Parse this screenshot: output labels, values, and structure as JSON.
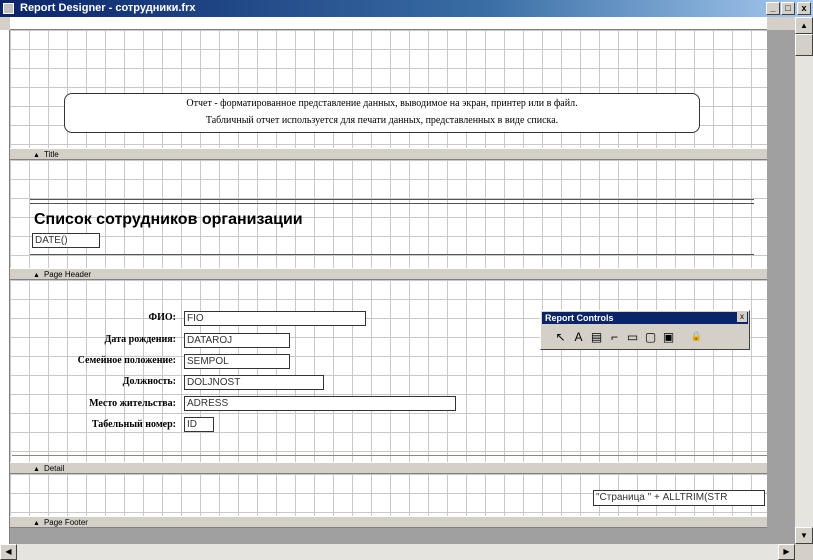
{
  "window": {
    "title": "Report Designer - сотрудники.frx",
    "minimize_glyph": "_",
    "restore_glyph": "□",
    "close_glyph": "x"
  },
  "bands": {
    "title": "Title",
    "page_header": "Page Header",
    "detail": "Detail",
    "page_footer": "Page Footer"
  },
  "description": {
    "line1": "Отчет - форматированное представление данных, выводимое на экран, принтер или в файл.",
    "line2": "Табличный отчет используется для печати данных, представленных в виде списка."
  },
  "report": {
    "heading": "Список сотрудников организации",
    "date_field": "DATE()"
  },
  "detail_fields": [
    {
      "label": "ФИО:",
      "expr": "FIO"
    },
    {
      "label": "Дата рождения:",
      "expr": "DATAROJ"
    },
    {
      "label": "Семейное положение:",
      "expr": "SEMPOL"
    },
    {
      "label": "Должность:",
      "expr": "DOLJNOST"
    },
    {
      "label": "Место жительства:",
      "expr": "ADRESS"
    },
    {
      "label": "Табельный номер:",
      "expr": "ID"
    }
  ],
  "footer": {
    "page_expr": "\"Страница \" + ALLTRIM(STR"
  },
  "palette": {
    "title": "Report Controls",
    "close": "x",
    "tools": [
      {
        "name": "pointer-tool-icon",
        "glyph": "↖"
      },
      {
        "name": "label-tool-icon",
        "glyph": "A"
      },
      {
        "name": "field-tool-icon",
        "glyph": "▤"
      },
      {
        "name": "line-tool-icon",
        "glyph": "⌐"
      },
      {
        "name": "rectangle-tool-icon",
        "glyph": "▭"
      },
      {
        "name": "rounded-rectangle-tool-icon",
        "glyph": "▢"
      },
      {
        "name": "picture-tool-icon",
        "glyph": "▣"
      },
      {
        "name": "lock-tool-icon",
        "glyph": "🔒"
      }
    ]
  },
  "colors": {
    "titlebar": "#0a246a",
    "grid": "#c8c8c8",
    "band_bar": "#d4d0c8"
  }
}
